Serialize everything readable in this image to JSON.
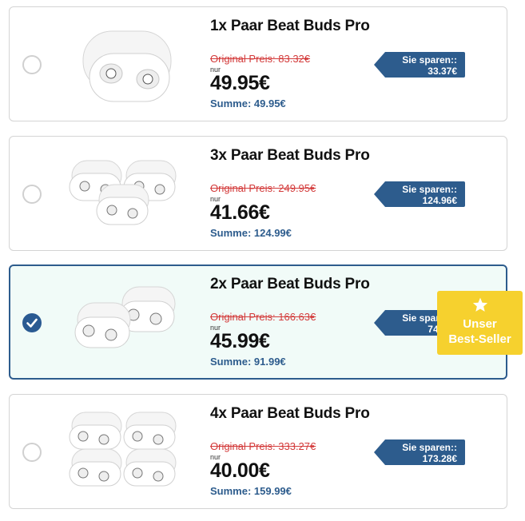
{
  "offers": [
    {
      "title": "1x Paar Beat Buds Pro",
      "original_price": "Original Preis: 83.32€",
      "nur": "nur",
      "price": "49.95€",
      "sum": "Summe: 49.95€",
      "save_label": "Sie sparen::",
      "save_amount": "33.37€",
      "selected": false
    },
    {
      "title": "3x Paar Beat Buds Pro",
      "original_price": "Original Preis: 249.95€",
      "nur": "nur",
      "price": "41.66€",
      "sum": "Summe: 124.99€",
      "save_label": "Sie sparen::",
      "save_amount": "124.96€",
      "selected": false
    },
    {
      "title": "2x Paar Beat Buds Pro",
      "original_price": "Original Preis: 166.63€",
      "nur": "nur",
      "price": "45.99€",
      "sum": "Summe: 91.99€",
      "save_label": "Sie sparen::",
      "save_amount": "74.64€",
      "selected": true
    },
    {
      "title": "4x Paar Beat Buds Pro",
      "original_price": "Original Preis: 333.27€",
      "nur": "nur",
      "price": "40.00€",
      "sum": "Summe: 159.99€",
      "save_label": "Sie sparen::",
      "save_amount": "173.28€",
      "selected": false
    }
  ],
  "badge": {
    "line1": "Unser",
    "line2": "Best-Seller",
    "icon": "star-icon"
  },
  "colors": {
    "accent": "#2d5c8d",
    "strike": "#d33a3a",
    "badge": "#f6d12e",
    "selected_bg": "#f1fbf8"
  }
}
